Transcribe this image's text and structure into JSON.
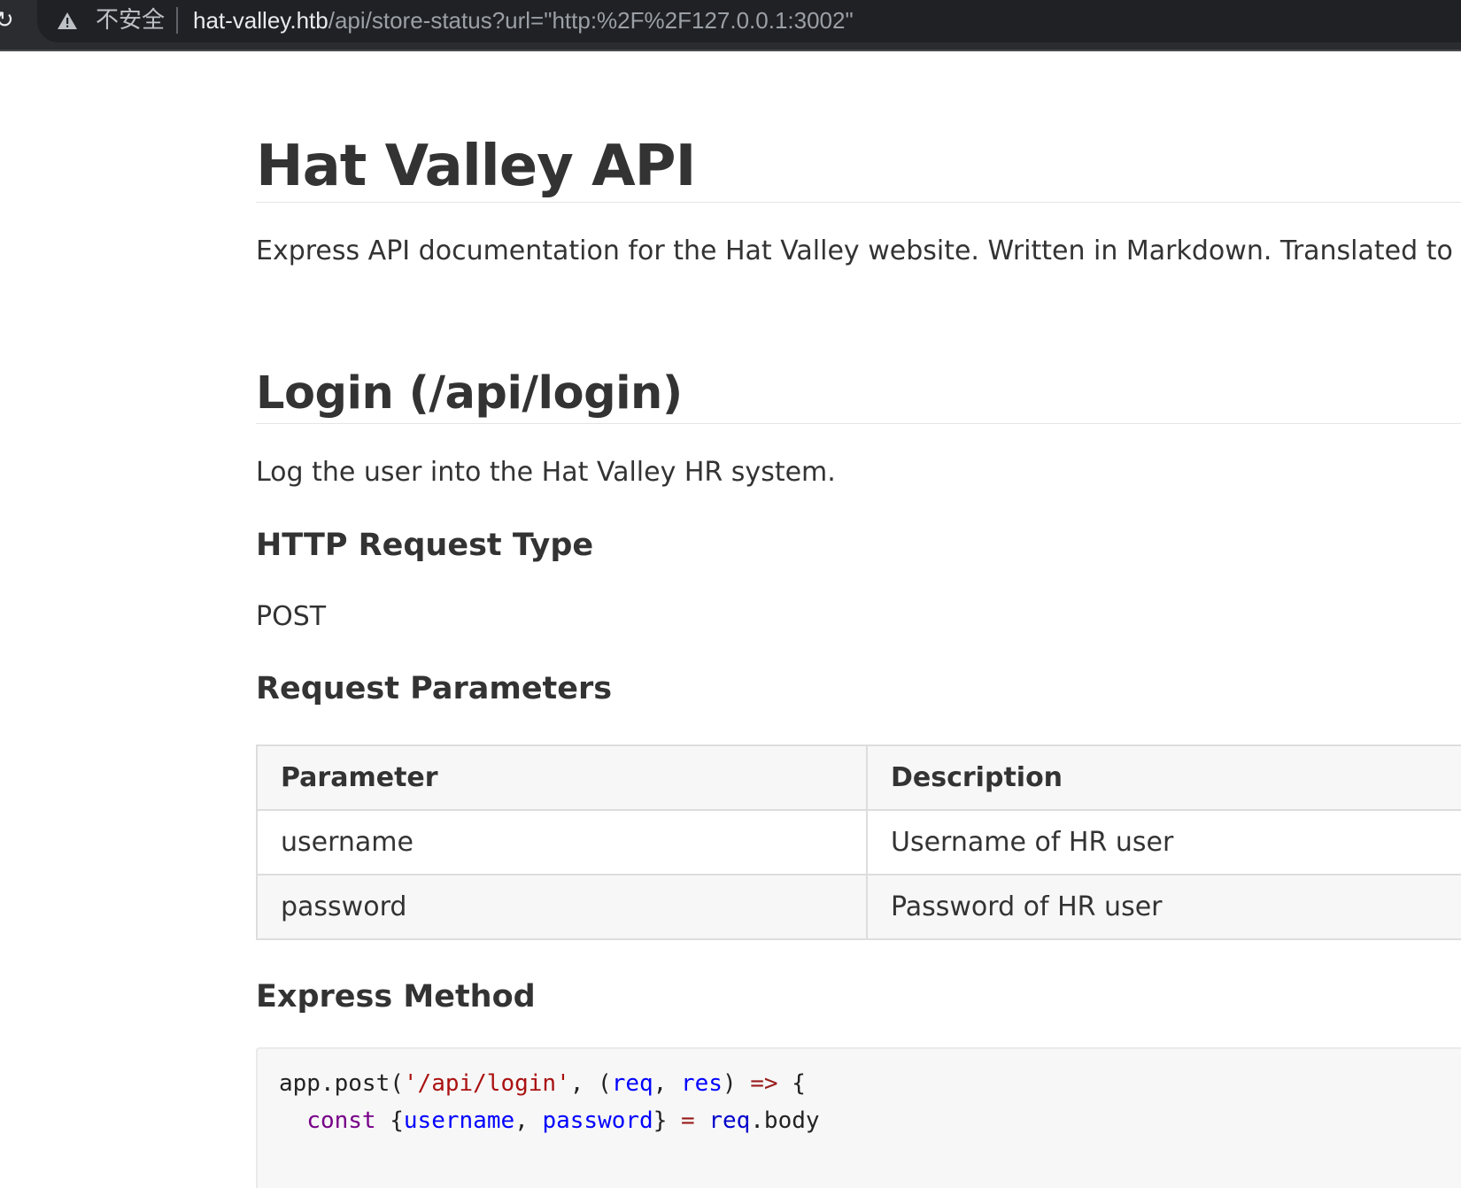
{
  "browser": {
    "security_label": "不安全",
    "url_host": "hat-valley.htb",
    "url_path": "/api/store-status?url=\"http:%2F%2F127.0.0.1:3002\""
  },
  "page": {
    "title": "Hat Valley API",
    "intro": "Express API documentation for the Hat Valley website. Written in Markdown. Translated to",
    "login_heading": "Login (/api/login)",
    "login_desc": "Log the user into the Hat Valley HR system.",
    "request_type_heading": "HTTP Request Type",
    "request_type": "POST",
    "params_heading": "Request Parameters",
    "params_table": {
      "headers": [
        "Parameter",
        "Description"
      ],
      "rows": [
        [
          "username",
          "Username of HR user"
        ],
        [
          "password",
          "Password of HR user"
        ]
      ]
    },
    "express_heading": "Express Method",
    "code": {
      "l1_a": "app.post(",
      "l1_str": "'/api/login'",
      "l1_b": ", (",
      "l1_req": "req",
      "l1_c": ", ",
      "l1_res": "res",
      "l1_d": ") ",
      "l1_arrow": "=>",
      "l1_e": " {",
      "l2_indent": "  ",
      "l2_const": "const",
      "l2_a": " {",
      "l2_user": "username",
      "l2_b": ", ",
      "l2_pass": "password",
      "l2_c": "} ",
      "l2_eq": "=",
      "l2_d": " ",
      "l2_req": "req",
      "l2_e": ".body"
    }
  }
}
